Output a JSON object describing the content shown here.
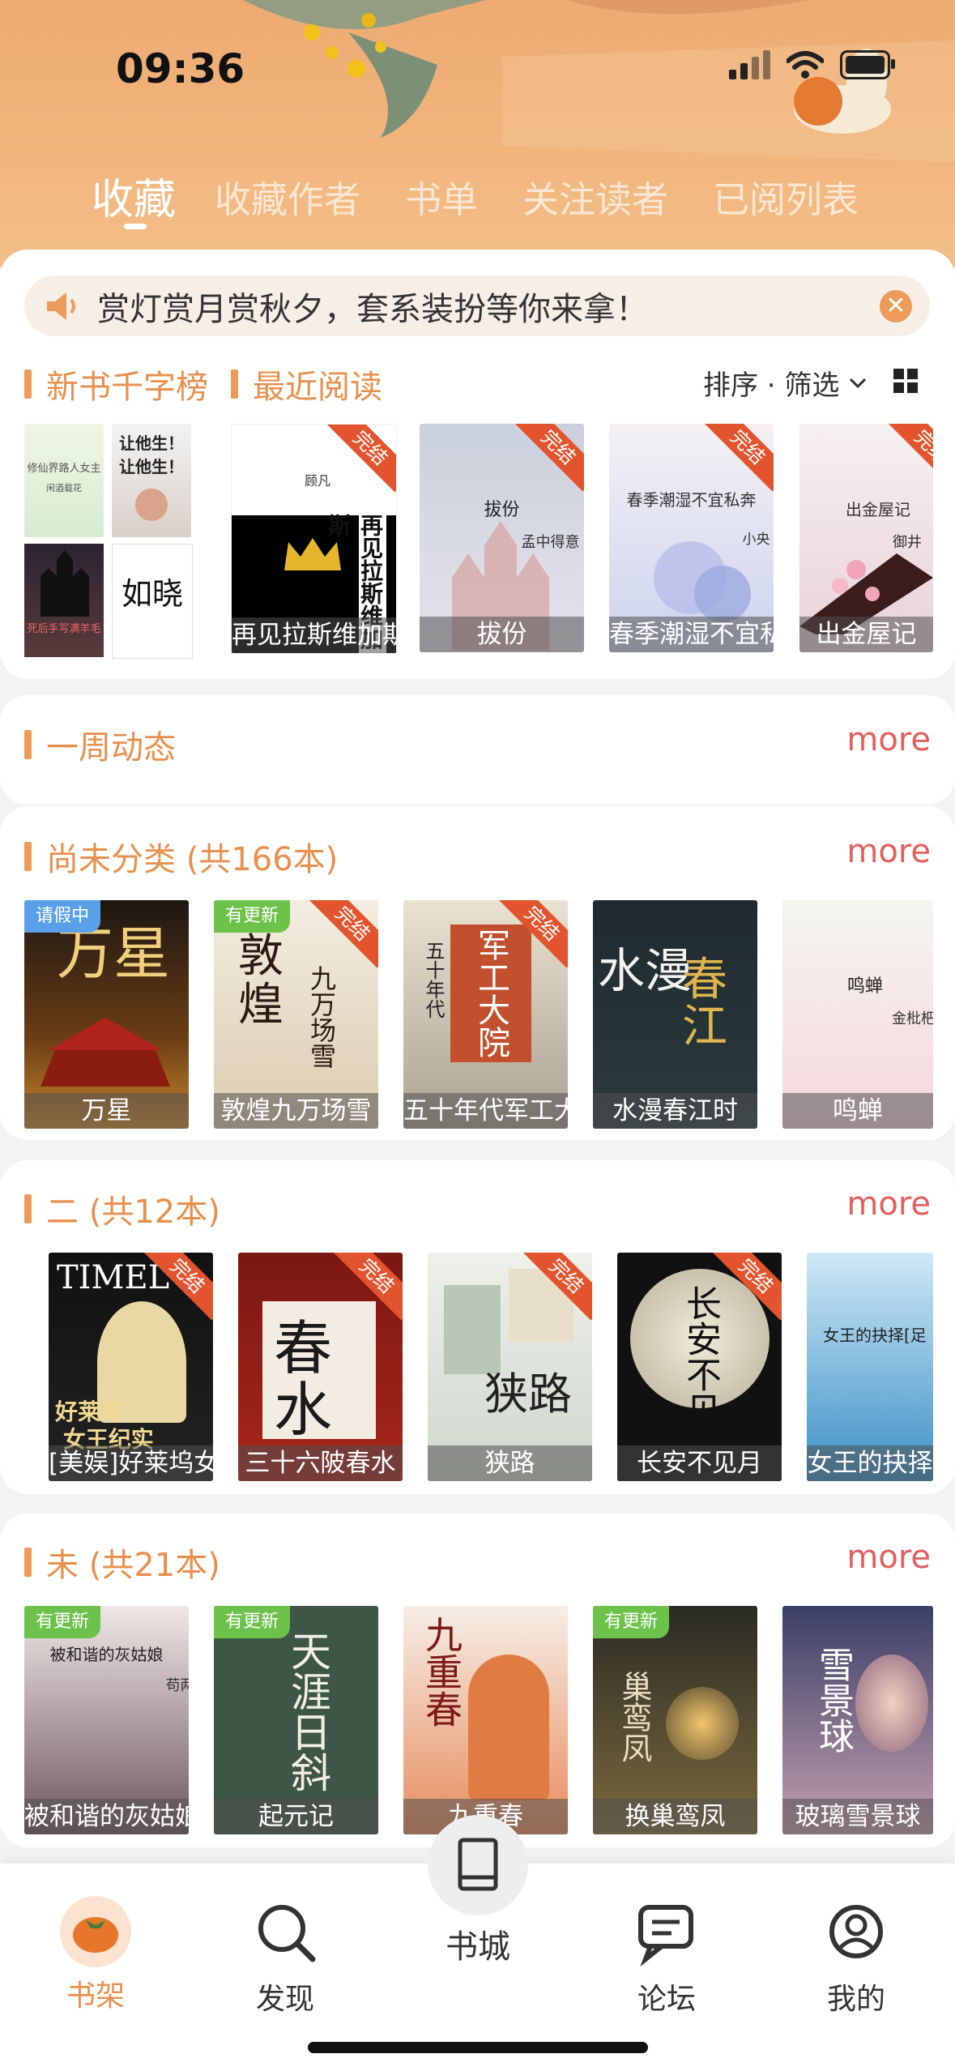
{
  "status_bar": {
    "time": "09:36"
  },
  "tabs": [
    {
      "label": "收藏",
      "active": true
    },
    {
      "label": "收藏作者",
      "active": false
    },
    {
      "label": "书单",
      "active": false
    },
    {
      "label": "关注读者",
      "active": false
    },
    {
      "label": "已阅列表",
      "active": false
    }
  ],
  "notice": {
    "text": "赏灯赏月赏秋夕，套系装扮等你来拿！",
    "icon": "speaker-icon"
  },
  "shelf_header": {
    "tab1": "新书千字榜",
    "tab2": "最近阅读",
    "sort_filter": "排序 · 筛选"
  },
  "recent": {
    "grid_covers": [
      "修仙界路人女主",
      "让他生！让他生！",
      "死后手写满羊毛",
      "如晓"
    ],
    "grid_cover_sub": "闲酒载花",
    "books": [
      {
        "caption": "再见拉斯维加斯",
        "inner": "顾凡",
        "inner2": "再见拉斯维加斯",
        "badge": "完结"
      },
      {
        "caption": "拔份",
        "inner": "拔份",
        "inner2": "孟中得意",
        "badge": "完结"
      },
      {
        "caption": "春季潮湿不宜私奔",
        "inner": "春季潮湿不宜私奔",
        "inner2": "小央",
        "badge": "完结"
      },
      {
        "caption": "出金屋记",
        "inner": "出金屋记",
        "inner2": "御井",
        "badge": "完结"
      }
    ]
  },
  "weekly": {
    "title": "一周动态",
    "more": "more"
  },
  "section_uncat": {
    "title": "尚未分类 (共166本)",
    "more": "more",
    "books": [
      {
        "caption": "万星",
        "badge": "请假中",
        "ribbon": ""
      },
      {
        "caption": "敦煌九万场雪",
        "badge": "有更新",
        "ribbon": "完结"
      },
      {
        "caption": "五十年代军工大院",
        "badge": "",
        "ribbon": "完结"
      },
      {
        "caption": "水漫春江时",
        "badge": "",
        "ribbon": ""
      },
      {
        "caption": "鸣蝉",
        "badge": "",
        "ribbon": "",
        "inner": "鸣蝉",
        "inner2": "金枇杷"
      }
    ]
  },
  "section_two": {
    "title": "二 (共12本)",
    "more": "more",
    "books": [
      {
        "caption": "[美娱]好莱坞女王纪实",
        "ribbon": "完结"
      },
      {
        "caption": "三十六陂春水",
        "ribbon": "完结"
      },
      {
        "caption": "狭路",
        "ribbon": "完结"
      },
      {
        "caption": "长安不见月",
        "ribbon": "完结"
      },
      {
        "caption": "女王的抉择",
        "ribbon": "",
        "inner": "女王的抉择[足"
      }
    ]
  },
  "section_wei": {
    "title": "未 (共21本)",
    "more": "more",
    "books": [
      {
        "caption": "被和谐的灰姑娘",
        "badge": "有更新",
        "inner": "被和谐的灰姑娘",
        "inner2": "苟两两"
      },
      {
        "caption": "起元记",
        "badge": "有更新"
      },
      {
        "caption": "九重春",
        "badge": ""
      },
      {
        "caption": "换巢鸾凤",
        "badge": "有更新"
      },
      {
        "caption": "玻璃雪景球",
        "badge": ""
      }
    ]
  },
  "nav": [
    {
      "label": "书架",
      "icon": "persimmon-icon",
      "active": true
    },
    {
      "label": "发现",
      "icon": "search-icon",
      "active": false
    },
    {
      "label": "书城",
      "icon": "book-icon",
      "active": false
    },
    {
      "label": "论坛",
      "icon": "chat-icon",
      "active": false
    },
    {
      "label": "我的",
      "icon": "user-icon",
      "active": false
    }
  ],
  "colors": {
    "accent": "#e98f4c",
    "more": "#e55e5a",
    "ribbon": "#e2542d",
    "badge_update": "#6cc24a",
    "badge_leave": "#5aa0e8"
  }
}
